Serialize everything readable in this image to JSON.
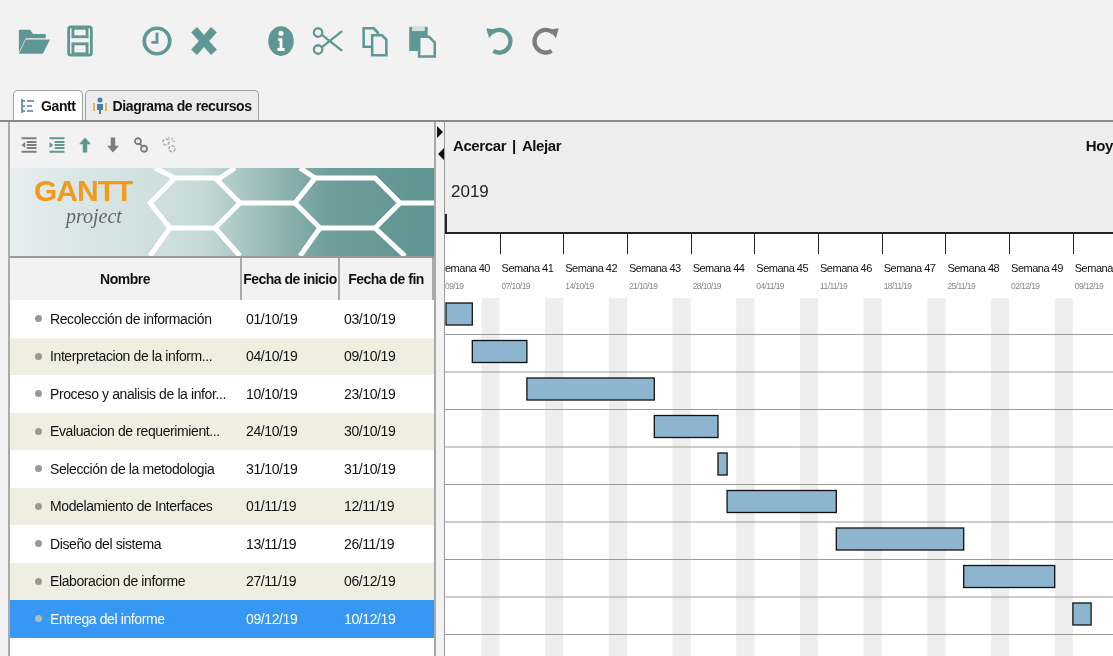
{
  "toolbar": [
    {
      "disabled": false
    },
    {
      "disabled": false
    },
    {
      "disabled": false
    },
    {
      "disabled": false
    },
    {
      "disabled": false
    },
    {
      "disabled": false
    },
    {
      "disabled": false
    },
    {
      "disabled": false
    },
    {
      "disabled": false
    },
    {
      "disabled": true
    }
  ],
  "tabs": [
    {
      "label": "Gantt",
      "selected": true
    },
    {
      "label": "Diagrama de recursos",
      "selected": false
    }
  ],
  "task_toolbar": [
    {
      "disabled": true
    },
    {
      "disabled": false
    },
    {
      "disabled": false
    },
    {
      "disabled": true
    },
    {
      "disabled": true
    },
    {
      "disabled": true
    }
  ],
  "logo": {
    "name": "GANTT",
    "subtitle": "project"
  },
  "table": {
    "columns": [
      "Nombre",
      "Fecha de inicio",
      "Fecha de fin"
    ],
    "rows": [
      {
        "name": "Recolección de información",
        "start": "01/10/19",
        "end": "03/10/19",
        "selected": false
      },
      {
        "name": "Interpretacion de la inform...",
        "start": "04/10/19",
        "end": "09/10/19",
        "selected": false
      },
      {
        "name": "Proceso y analisis de la infor...",
        "start": "10/10/19",
        "end": "23/10/19",
        "selected": false
      },
      {
        "name": "Evaluacion de requerimient...",
        "start": "24/10/19",
        "end": "30/10/19",
        "selected": false
      },
      {
        "name": "Selección de la metodologia",
        "start": "31/10/19",
        "end": "31/10/19",
        "selected": false
      },
      {
        "name": "Modelamiento de Interfaces",
        "start": "01/11/19",
        "end": "12/11/19",
        "selected": false
      },
      {
        "name": "Diseño del sistema",
        "start": "13/11/19",
        "end": "26/11/19",
        "selected": false
      },
      {
        "name": "Elaboracion de informe",
        "start": "27/11/19",
        "end": "06/12/19",
        "selected": false
      },
      {
        "name": "Entrega del informe",
        "start": "09/12/19",
        "end": "10/12/19",
        "selected": true
      }
    ]
  },
  "timeline": {
    "zoom_in": "Acercar",
    "separator": "|",
    "zoom_out": "Alejar",
    "today": "Hoy",
    "year": "2019",
    "weeks": [
      {
        "label": "emana 40",
        "date": "09/19"
      },
      {
        "label": "Semana 41",
        "date": "07/10/19"
      },
      {
        "label": "Semana 42",
        "date": "14/10/19"
      },
      {
        "label": "Semana 43",
        "date": "21/10/19"
      },
      {
        "label": "Semana 44",
        "date": "28/10/19"
      },
      {
        "label": "Semana 45",
        "date": "04/11/19"
      },
      {
        "label": "Semana 46",
        "date": "11/11/19"
      },
      {
        "label": "Semana 47",
        "date": "18/11/19"
      },
      {
        "label": "Semana 48",
        "date": "25/11/19"
      },
      {
        "label": "Semana 49",
        "date": "02/12/19"
      },
      {
        "label": "Semana",
        "date": "09/12/19"
      }
    ]
  }
}
